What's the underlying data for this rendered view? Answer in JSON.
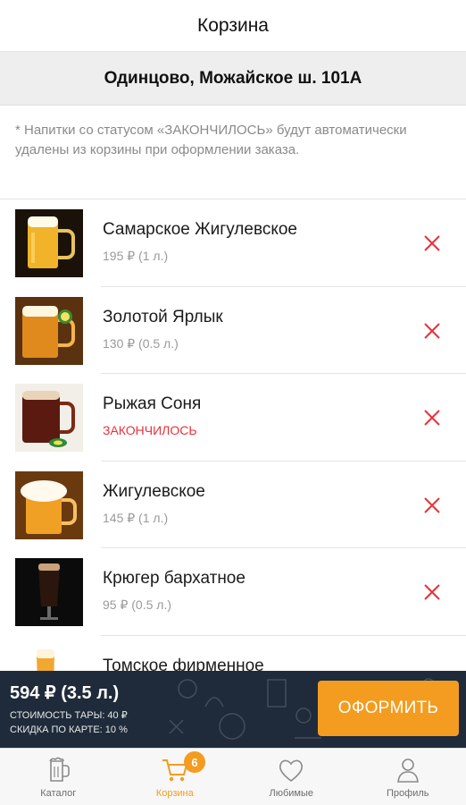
{
  "header": {
    "title": "Корзина"
  },
  "address": {
    "text": "Одинцово, Можайское ш. 101А"
  },
  "notice": {
    "text": "* Напитки со статусом «ЗАКОНЧИЛОСЬ» будут автоматически удалены из корзины при оформлении заказа."
  },
  "items": [
    {
      "name": "Самарское Жигулевское",
      "price": "195 ₽ (1 л.)",
      "out_of_stock": false,
      "icon": "beer-mug-light-icon"
    },
    {
      "name": "Золотой Ярлык",
      "price": "130 ₽ (0.5 л.)",
      "out_of_stock": false,
      "icon": "beer-mug-amber-icon"
    },
    {
      "name": "Рыжая Соня",
      "price": "ЗАКОНЧИЛОСЬ",
      "out_of_stock": true,
      "icon": "beer-mug-red-icon"
    },
    {
      "name": "Жигулевское",
      "price": "145 ₽ (1 л.)",
      "out_of_stock": false,
      "icon": "beer-mug-foam-icon"
    },
    {
      "name": "Крюгер бархатное",
      "price": "95 ₽ (0.5 л.)",
      "out_of_stock": false,
      "icon": "dark-beer-glass-icon"
    },
    {
      "name": "Томское фирменное",
      "price": "",
      "out_of_stock": false,
      "icon": "beer-glass-icon"
    }
  ],
  "summary": {
    "total": "594 ₽ (3.5 л.)",
    "container_cost": "СТОИМОСТЬ ТАРЫ: 40 ₽",
    "card_discount": "СКИДКА ПО КАРТЕ: 10 %",
    "checkout_label": "ОФОРМИТЬ"
  },
  "tabs": [
    {
      "label": "Каталог",
      "icon": "beer-mug-outline-icon",
      "active": false
    },
    {
      "label": "Корзина",
      "icon": "cart-icon",
      "active": true,
      "badge": "6"
    },
    {
      "label": "Любимые",
      "icon": "heart-icon",
      "active": false
    },
    {
      "label": "Профиль",
      "icon": "user-icon",
      "active": false
    }
  ],
  "colors": {
    "accent": "#f39c1f",
    "out_of_stock": "#e8313a",
    "summary_bg": "#1f2b3a"
  }
}
